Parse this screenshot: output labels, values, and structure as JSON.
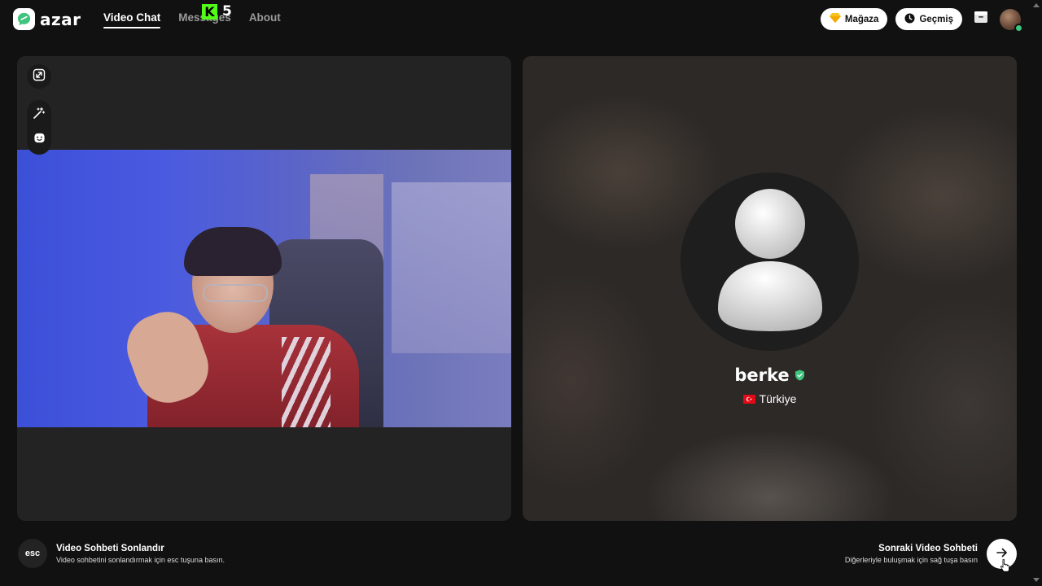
{
  "app": {
    "logo_text": "azar",
    "logo_icon": "azar-chat-bubble-icon",
    "accent": "#3ec47c"
  },
  "nav": {
    "items": [
      {
        "label": "Video Chat",
        "active": true
      },
      {
        "label": "Messages",
        "active": false
      },
      {
        "label": "About",
        "active": false
      }
    ]
  },
  "overlay_badge": {
    "letter": "K",
    "count": "5",
    "color": "#53fc18"
  },
  "header_actions": {
    "store_label": "Mağaza",
    "store_icon": "gem-icon",
    "history_label": "Geçmiş",
    "history_icon": "clock-icon",
    "inbox_icon": "inbox-icon",
    "avatar_icon": "user-avatar"
  },
  "left_panel": {
    "tools": [
      "expand-icon",
      "magic-wand-icon",
      "face-mask-icon"
    ]
  },
  "remote_user": {
    "name": "berke",
    "verified": true,
    "country": "Türkiye",
    "flag": "turkey-flag"
  },
  "bottom": {
    "esc_key_label": "esc",
    "end_title": "Video Sohbeti Sonlandır",
    "end_hint": "Video sohbetini sonlandırmak için esc tuşuna basın.",
    "next_title": "Sonraki Video Sohbeti",
    "next_hint": "Diğerleriyle buluşmak için sağ tuşa basın",
    "next_icon": "arrow-right-icon"
  }
}
